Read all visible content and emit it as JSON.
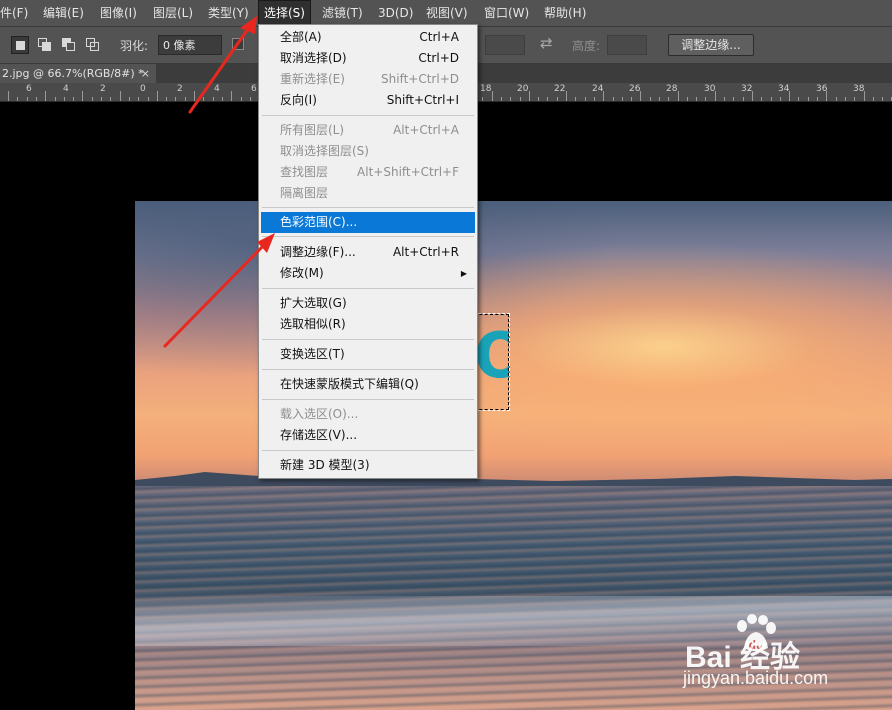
{
  "menubar": {
    "items": [
      {
        "label": "件(F)"
      },
      {
        "label": "编辑(E)"
      },
      {
        "label": "图像(I)"
      },
      {
        "label": "图层(L)"
      },
      {
        "label": "类型(Y)"
      },
      {
        "label": "选择(S)"
      },
      {
        "label": "滤镜(T)"
      },
      {
        "label": "3D(D)"
      },
      {
        "label": "视图(V)"
      },
      {
        "label": "窗口(W)"
      },
      {
        "label": "帮助(H)"
      }
    ],
    "active_index": 5
  },
  "options_bar": {
    "feather_label": "羽化:",
    "feather_value": "0 像素",
    "height_label": "高度:",
    "refine_edge_button": "调整边缘..."
  },
  "document": {
    "tab_title": "2.jpg @ 66.7%(RGB/8#) *",
    "close_glyph": "×"
  },
  "ruler": {
    "labels": [
      "6",
      "4",
      "2",
      "0",
      "2",
      "4",
      "6",
      "18",
      "20",
      "22",
      "24",
      "26",
      "28",
      "30",
      "32",
      "34",
      "36",
      "38"
    ]
  },
  "select_menu": {
    "items": [
      {
        "label": "全部(A)",
        "shortcut": "Ctrl+A",
        "enabled": true
      },
      {
        "label": "取消选择(D)",
        "shortcut": "Ctrl+D",
        "enabled": true
      },
      {
        "label": "重新选择(E)",
        "shortcut": "Shift+Ctrl+D",
        "enabled": false
      },
      {
        "label": "反向(I)",
        "shortcut": "Shift+Ctrl+I",
        "enabled": true
      },
      {
        "label": "所有图层(L)",
        "shortcut": "Alt+Ctrl+A",
        "enabled": false
      },
      {
        "label": "取消选择图层(S)",
        "shortcut": "",
        "enabled": false
      },
      {
        "label": "查找图层",
        "shortcut": "Alt+Shift+Ctrl+F",
        "enabled": false
      },
      {
        "label": "隔离图层",
        "shortcut": "",
        "enabled": false
      },
      {
        "label": "色彩范围(C)...",
        "shortcut": "",
        "enabled": true,
        "highlighted": true
      },
      {
        "label": "调整边缘(F)...",
        "shortcut": "Alt+Ctrl+R",
        "enabled": true
      },
      {
        "label": "修改(M)",
        "shortcut": "",
        "enabled": true,
        "submenu": true
      },
      {
        "label": "扩大选取(G)",
        "shortcut": "",
        "enabled": true
      },
      {
        "label": "选取相似(R)",
        "shortcut": "",
        "enabled": true
      },
      {
        "label": "变换选区(T)",
        "shortcut": "",
        "enabled": true
      },
      {
        "label": "在快速蒙版模式下编辑(Q)",
        "shortcut": "",
        "enabled": true
      },
      {
        "label": "载入选区(O)...",
        "shortcut": "",
        "enabled": false
      },
      {
        "label": "存储选区(V)...",
        "shortcut": "",
        "enabled": true
      },
      {
        "label": "新建 3D 模型(3)",
        "shortcut": "",
        "enabled": true
      }
    ],
    "submenu_glyph": "▶"
  },
  "canvas": {
    "visible_letter": "O"
  },
  "watermark": {
    "logo": "Bai  经验",
    "url": "jingyan.baidu.com"
  },
  "colors": {
    "menu_highlight": "#0a78d7",
    "annotation_arrow": "#e8281e",
    "ui_dark": "#535353"
  }
}
